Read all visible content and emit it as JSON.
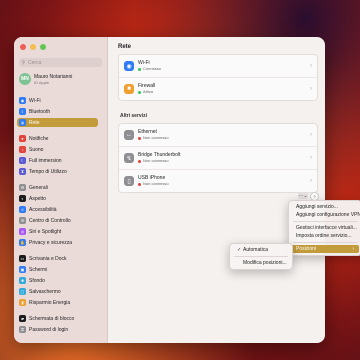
{
  "colors": {
    "accent": "#c29b3a",
    "connected": "#34c759",
    "disconnected": "#e0443b"
  },
  "sidebar": {
    "search_placeholder": "Cerca",
    "user": {
      "initials": "MN",
      "name": "Mauro Notarianni",
      "subtitle": "ID Apple"
    },
    "items": [
      {
        "label": "Wi-Fi",
        "icon": "wifi-icon"
      },
      {
        "label": "Bluetooth",
        "icon": "bluetooth-icon"
      },
      {
        "label": "Rete",
        "icon": "network-icon",
        "active": true
      },
      {
        "label": "Notifiche",
        "icon": "bell-icon"
      },
      {
        "label": "Suono",
        "icon": "speaker-icon"
      },
      {
        "label": "Full immersion",
        "icon": "moon-icon"
      },
      {
        "label": "Tempo di Utilizzo",
        "icon": "hourglass-icon"
      },
      {
        "label": "Generali",
        "icon": "gear-icon"
      },
      {
        "label": "Aspetto",
        "icon": "appearance-icon"
      },
      {
        "label": "Accessibilità",
        "icon": "accessibility-icon"
      },
      {
        "label": "Centro di Controllo",
        "icon": "control-center-icon"
      },
      {
        "label": "Siri e Spotlight",
        "icon": "siri-icon"
      },
      {
        "label": "Privacy e sicurezza",
        "icon": "hand-icon"
      },
      {
        "label": "Scrivania e Dock",
        "icon": "dock-icon"
      },
      {
        "label": "Schermi",
        "icon": "display-icon"
      },
      {
        "label": "Sfondo",
        "icon": "wallpaper-icon"
      },
      {
        "label": "Salvaschermo",
        "icon": "screensaver-icon"
      },
      {
        "label": "Risparmio Energia",
        "icon": "battery-icon"
      },
      {
        "label": "Schermata di blocco",
        "icon": "lock-icon"
      },
      {
        "label": "Password di login",
        "icon": "key-icon"
      }
    ]
  },
  "main": {
    "title": "Rete",
    "services": [
      {
        "name": "Wi-Fi",
        "status": "Connesso",
        "connected": true,
        "icon": "wifi-icon"
      },
      {
        "name": "Firewall",
        "status": "Attiva",
        "connected": true,
        "icon": "firewall-icon"
      }
    ],
    "other_label": "Altri servizi",
    "other_services": [
      {
        "name": "Ethernet",
        "status": "Non connesso",
        "connected": false,
        "icon": "ethernet-icon"
      },
      {
        "name": "Bridge Thunderbolt",
        "status": "Non connesso",
        "connected": false,
        "icon": "thunderbolt-icon"
      },
      {
        "name": "USB iPhone",
        "status": "Non connesso",
        "connected": false,
        "icon": "iphone-icon"
      }
    ],
    "more_label": "···",
    "more_chevron": "⌄",
    "help_label": "?"
  },
  "action_menu": {
    "items": [
      "Aggiungi servizio...",
      "Aggiungi configurazione VPN",
      "Gestisci interfacce virtuali...",
      "Imposta ordine servizio...",
      "Posizioni"
    ]
  },
  "locations_submenu": {
    "items": [
      {
        "label": "Automatica",
        "checked": true
      },
      {
        "label": "Modifica posizioni...",
        "checked": false
      }
    ]
  }
}
